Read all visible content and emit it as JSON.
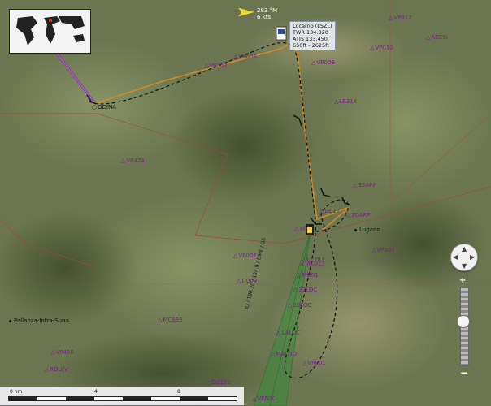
{
  "aircraft_info": {
    "heading": "283 °M",
    "speed": "6 kts"
  },
  "airport": {
    "name": "Locarno (LSZL)",
    "twr": "TWR",
    "twr_freq": "134.820",
    "atis": "ATIS 133.450",
    "elevation": "650ft - 2625ft"
  },
  "waypoints": [
    {
      "name": "VP012"
    },
    {
      "name": "ABESI"
    },
    {
      "name": "VP010"
    },
    {
      "name": "VP008"
    },
    {
      "name": "VP007"
    },
    {
      "name": "VP009"
    },
    {
      "name": "LS214"
    },
    {
      "name": "ODINA"
    },
    {
      "name": "VP474"
    },
    {
      "name": "32ARP"
    },
    {
      "name": "D017"
    },
    {
      "name": "20ARP"
    },
    {
      "name": "VP"
    },
    {
      "name": "VP002"
    },
    {
      "name": "LZ7ILL"
    },
    {
      "name": "D009T"
    },
    {
      "name": "MC017"
    },
    {
      "name": "MG01"
    },
    {
      "name": "32LOC"
    },
    {
      "name": "20LOC"
    },
    {
      "name": "MC695"
    },
    {
      "name": "VP003"
    },
    {
      "name": "VP460"
    },
    {
      "name": "RDUJV"
    },
    {
      "name": "LALOC"
    },
    {
      "name": "MALDO"
    },
    {
      "name": "VP001"
    },
    {
      "name": "D2121"
    },
    {
      "name": "VENIK"
    }
  ],
  "towns": [
    {
      "name": "Lugano"
    },
    {
      "name": "Pallanza-Intra-Suna"
    }
  ],
  "approach_label": "ILI / 108.70 / 124.9 / DME / GS",
  "scale": {
    "labels": [
      "0 nm",
      "4",
      "8"
    ]
  },
  "zoom": {
    "plus": "+",
    "minus": "−",
    "level": 0.6
  },
  "colors": {
    "route_orange": "#d08a28",
    "waypoint": "#7a1f8a",
    "approach_cone": "#3a8a3a",
    "ground_track": "#111111"
  }
}
